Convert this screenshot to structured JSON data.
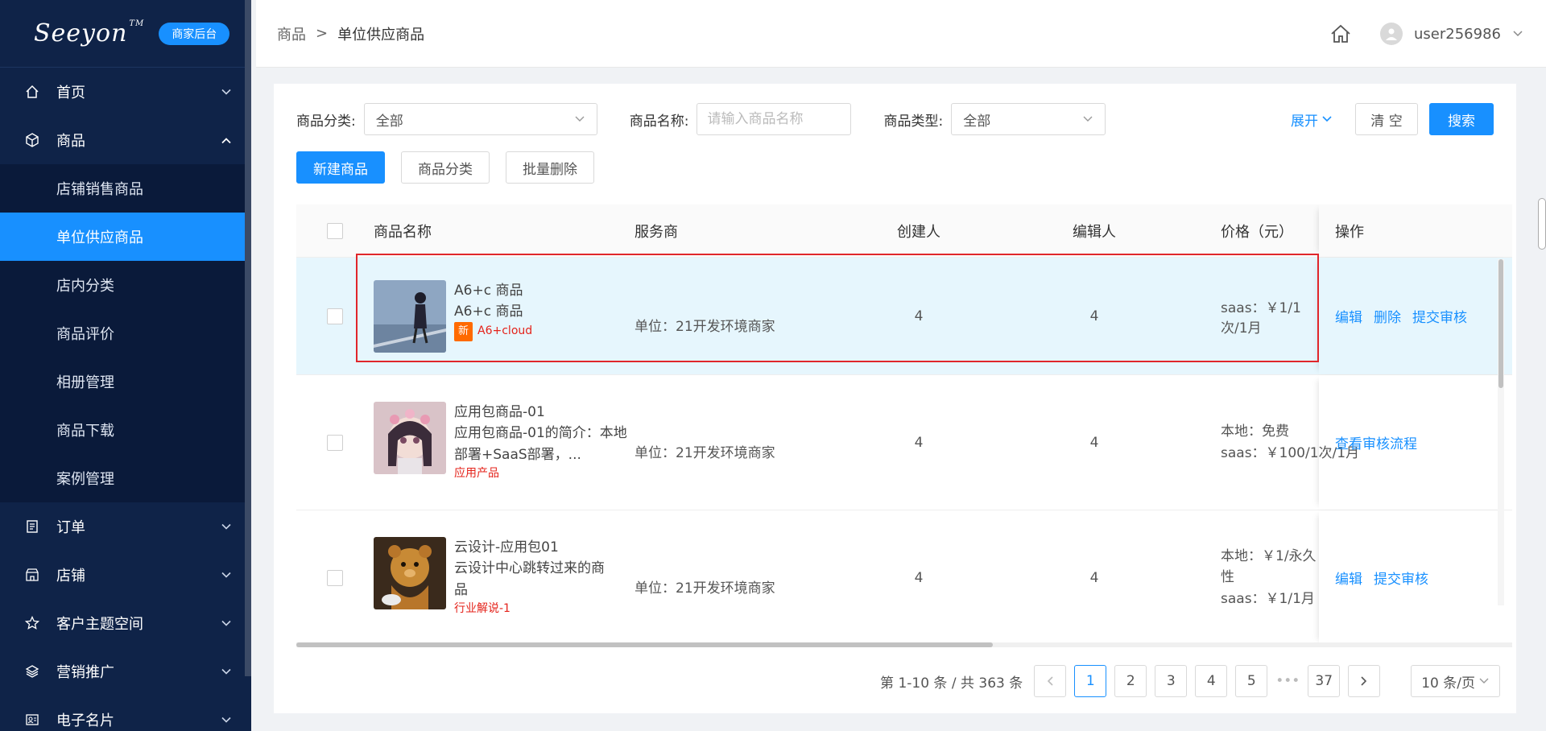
{
  "brand": {
    "logo": "Seeyon",
    "badge": "商家后台"
  },
  "sidebar": {
    "items": [
      {
        "label": "首页",
        "icon": "home-icon"
      },
      {
        "label": "商品",
        "icon": "cube-icon",
        "expanded": true,
        "children": [
          "店铺销售商品",
          "单位供应商品",
          "店内分类",
          "商品评价",
          "相册管理",
          "商品下载",
          "案例管理"
        ]
      },
      {
        "label": "订单",
        "icon": "order-icon"
      },
      {
        "label": "店铺",
        "icon": "store-icon"
      },
      {
        "label": "客户主题空间",
        "icon": "star-icon"
      },
      {
        "label": "营销推广",
        "icon": "layers-icon"
      },
      {
        "label": "电子名片",
        "icon": "card-icon"
      }
    ],
    "active_child": "单位供应商品"
  },
  "header": {
    "breadcrumb": [
      "商品",
      "单位供应商品"
    ],
    "separator": ">",
    "username": "user256986"
  },
  "filters": {
    "category_label": "商品分类:",
    "category_value": "全部",
    "name_label": "商品名称:",
    "name_placeholder": "请输入商品名称",
    "type_label": "商品类型:",
    "type_value": "全部",
    "expand": "展开",
    "clear": "清 空",
    "search": "搜索"
  },
  "actions": {
    "new": "新建商品",
    "category": "商品分类",
    "batch_delete": "批量删除"
  },
  "table": {
    "headers": {
      "name": "商品名称",
      "vendor": "服务商",
      "creator": "创建人",
      "editor": "编辑人",
      "price": "价格（元）",
      "ops": "操作"
    },
    "rows": [
      {
        "title": "A6+c 商品",
        "desc": "A6+c 商品",
        "tag": "A6+cloud",
        "new_badge": "新",
        "vendor": "单位：21开发环境商家",
        "creator": "4",
        "editor": "4",
        "price1": "saas：￥1/1次/1月",
        "price2": "",
        "ops": [
          "编辑",
          "删除",
          "提交审核"
        ]
      },
      {
        "title": "应用包商品-01",
        "desc": "应用包商品-01的简介：本地部署+SaaS部署，...",
        "tag": "应用产品",
        "vendor": "单位：21开发环境商家",
        "creator": "4",
        "editor": "4",
        "price1": "本地：免费",
        "price2": "saas：￥100/1次/1月",
        "ops": [
          "查看审核流程"
        ]
      },
      {
        "title": "云设计-应用包01",
        "desc": "云设计中心跳转过来的商品",
        "tag": "行业解说-1",
        "vendor": "单位：21开发环境商家",
        "creator": "4",
        "editor": "4",
        "price1": "本地：￥1/永久性",
        "price2": "saas：￥1/1月",
        "ops": [
          "编辑",
          "提交审核"
        ]
      }
    ]
  },
  "pagination": {
    "summary": "第 1-10 条 / 共 363 条",
    "pages": [
      "1",
      "2",
      "3",
      "4",
      "5"
    ],
    "ellipsis": "•••",
    "last": "37",
    "current": "1",
    "page_size": "10 条/页"
  },
  "colors": {
    "primary": "#1890ff",
    "sidebar": "#0f2348",
    "highlight_border": "#e0262b",
    "tag_red": "#e4231b"
  }
}
